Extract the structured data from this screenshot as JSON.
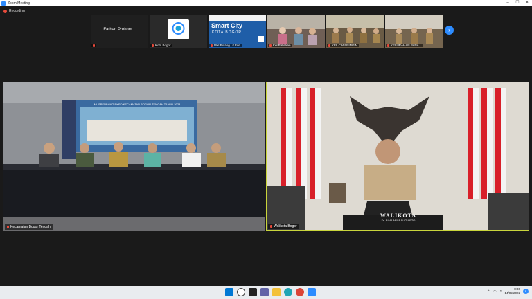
{
  "window": {
    "title": "Zoom Meeting"
  },
  "recording": {
    "label": "Recording"
  },
  "gallery": [
    {
      "name": "",
      "display_name": "Farhan Prokom..."
    },
    {
      "name": "Kota Bogor"
    },
    {
      "name": "DKI Bidang Lit Eve"
    },
    {
      "name": "Kel Babakan"
    },
    {
      "name": "KEL CIWARINGIN"
    },
    {
      "name": "KELURAHAN PANA..."
    }
  ],
  "thumb_smartcity": {
    "line1": "Smart City",
    "line2": "KOTA BOGOR"
  },
  "main_left": {
    "name": "Kecamatan Bogor Tengah",
    "banner_text": "MUSRENBANG RKPD KECAMATAN BOGOR TENGAH TAHUN 2023"
  },
  "main_right": {
    "name": "Walikota Bogor",
    "plaque_title": "WALIKOTA",
    "plaque_name": "Dr. BIMA ARYA SUGIARTO"
  },
  "taskbar": {
    "time": "8:36",
    "date": "14/02/2022"
  },
  "colors": {
    "accent": "#2d8cff",
    "speaker_border": "#c9d53c",
    "mic_off": "#e84a3b",
    "flag_red": "#d8202a"
  }
}
